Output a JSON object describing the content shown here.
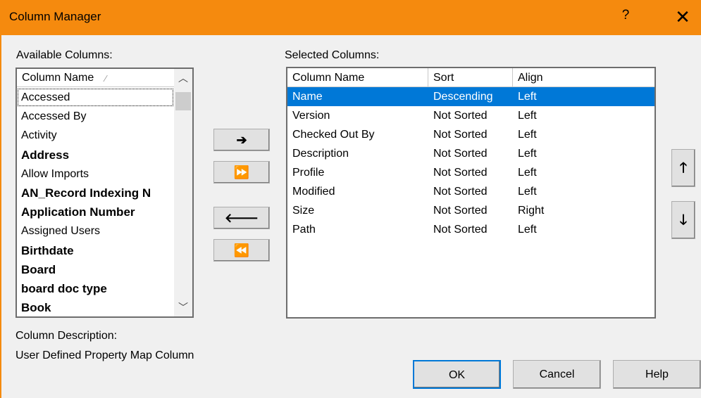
{
  "window": {
    "title": "Column Manager",
    "help": "?",
    "close": "✕"
  },
  "available": {
    "label": "Available Columns:",
    "header": "Column Name",
    "header_sort": "⁄",
    "items": [
      {
        "label": "Accessed",
        "bold": false
      },
      {
        "label": "Accessed By",
        "bold": false
      },
      {
        "label": "Activity",
        "bold": false
      },
      {
        "label": "Address",
        "bold": true
      },
      {
        "label": "Allow Imports",
        "bold": false
      },
      {
        "label": "AN_Record Indexing N",
        "bold": true
      },
      {
        "label": "Application Number",
        "bold": true
      },
      {
        "label": "Assigned Users",
        "bold": false
      },
      {
        "label": "Birthdate",
        "bold": true
      },
      {
        "label": "Board",
        "bold": true
      },
      {
        "label": "board doc type",
        "bold": true
      },
      {
        "label": "Book",
        "bold": true
      }
    ]
  },
  "transfer_buttons": {
    "add": "➔",
    "add_all": "⏩",
    "remove": "🡐",
    "remove_all": "⏪"
  },
  "selected": {
    "label": "Selected Columns:",
    "headers": [
      "Column Name",
      "Sort",
      "Align"
    ],
    "rows": [
      [
        "Name",
        "Descending",
        "Left"
      ],
      [
        "Version",
        "Not Sorted",
        "Left"
      ],
      [
        "Checked Out By",
        "Not Sorted",
        "Left"
      ],
      [
        "Description",
        "Not Sorted",
        "Left"
      ],
      [
        "Profile",
        "Not Sorted",
        "Left"
      ],
      [
        "Modified",
        "Not Sorted",
        "Left"
      ],
      [
        "Size",
        "Not Sorted",
        "Right"
      ],
      [
        "Path",
        "Not Sorted",
        "Left"
      ]
    ],
    "selected_index": 0
  },
  "move_buttons": {
    "up": "🡑",
    "down": "🡓"
  },
  "description": {
    "label": "Column Description:",
    "text": "User Defined Property Map Column"
  },
  "footer": {
    "ok": "OK",
    "cancel": "Cancel",
    "help": "Help"
  },
  "colors": {
    "titlebar": "#f58a0e",
    "selection": "#0078d7"
  }
}
